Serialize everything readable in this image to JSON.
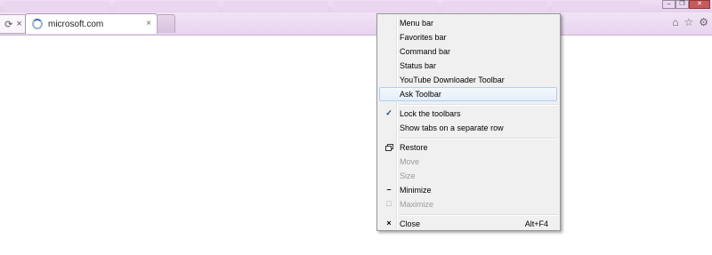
{
  "browser": {
    "tab_title": "microsoft.com",
    "tab_close": "×",
    "nav_stop": "×",
    "nav_refresh": "⟳"
  },
  "window_controls": {
    "minimize": "–",
    "restore": "❐",
    "close": "✕"
  },
  "menu": {
    "items": [
      {
        "label": "Menu bar"
      },
      {
        "label": "Favorites bar"
      },
      {
        "label": "Command bar"
      },
      {
        "label": "Status bar"
      },
      {
        "label": "YouTube Downloader Toolbar"
      },
      {
        "label": "Ask Toolbar",
        "highlighted": true
      },
      {
        "label": "Lock the toolbars",
        "checked": true
      },
      {
        "label": "Show tabs on a separate row"
      },
      {
        "label": "Restore",
        "icon": "restore-icon"
      },
      {
        "label": "Move",
        "disabled": true
      },
      {
        "label": "Size",
        "disabled": true
      },
      {
        "label": "Minimize",
        "icon": "minimize-icon"
      },
      {
        "label": "Maximize",
        "icon": "maximize-icon",
        "disabled": true
      },
      {
        "label": "Close",
        "icon": "close-icon",
        "shortcut": "Alt+F4"
      }
    ]
  },
  "colors": {
    "chrome": "#e8d4ef",
    "menu_bg": "#f0f0f0",
    "hover_border": "#aecff7"
  }
}
